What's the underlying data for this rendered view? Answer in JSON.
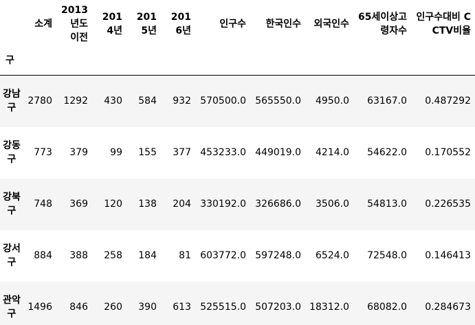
{
  "index_name": "구",
  "columns": [
    "소계",
    "2013년도 이전",
    "2014년",
    "2015년",
    "2016년",
    "인구수",
    "한국인수",
    "외국인수",
    "65세이상고령자수",
    "인구수대비 CCTV비율"
  ],
  "rows": [
    {
      "index": "강남구",
      "cells": [
        "2780",
        "1292",
        "430",
        "584",
        "932",
        "570500.0",
        "565550.0",
        "4950.0",
        "63167.0",
        "0.487292"
      ]
    },
    {
      "index": "강동구",
      "cells": [
        "773",
        "379",
        "99",
        "155",
        "377",
        "453233.0",
        "449019.0",
        "4214.0",
        "54622.0",
        "0.170552"
      ]
    },
    {
      "index": "강북구",
      "cells": [
        "748",
        "369",
        "120",
        "138",
        "204",
        "330192.0",
        "326686.0",
        "3506.0",
        "54813.0",
        "0.226535"
      ]
    },
    {
      "index": "강서구",
      "cells": [
        "884",
        "388",
        "258",
        "184",
        "81",
        "603772.0",
        "597248.0",
        "6524.0",
        "72548.0",
        "0.146413"
      ]
    },
    {
      "index": "관악구",
      "cells": [
        "1496",
        "846",
        "260",
        "390",
        "613",
        "525515.0",
        "507203.0",
        "18312.0",
        "68082.0",
        "0.284673"
      ]
    }
  ]
}
